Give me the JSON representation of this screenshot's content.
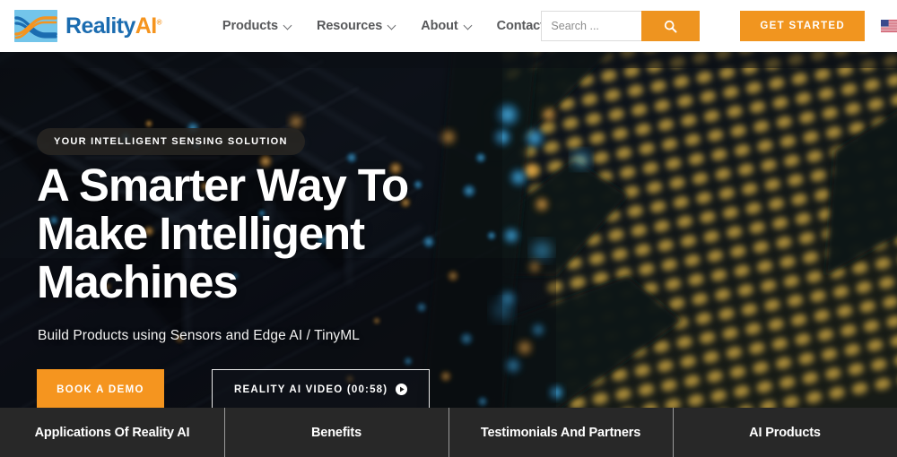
{
  "header": {
    "logo": {
      "icon": "reality-ai-waves-logo-icon",
      "text_primary": "Reality",
      "text_accent": "AI",
      "registered_mark": "®"
    },
    "nav": [
      {
        "label": "Products",
        "has_dropdown": true
      },
      {
        "label": "Resources",
        "has_dropdown": true
      },
      {
        "label": "About",
        "has_dropdown": true
      },
      {
        "label": "Contact",
        "has_dropdown": false
      }
    ],
    "search": {
      "placeholder": "Search ...",
      "value": "",
      "button_icon": "search-icon"
    },
    "get_started_label": "GET STARTED",
    "locale_flag": "us-flag-icon"
  },
  "hero": {
    "badge": "YOUR INTELLIGENT SENSING SOLUTION",
    "headline_line1": "A Smarter Way To",
    "headline_line2": "Make Intelligent",
    "headline_line3": "Machines",
    "subtitle": "Build Products using Sensors and Edge AI / TinyML",
    "cta_primary": "BOOK A DEMO",
    "cta_secondary": "REALITY AI VIDEO (00:58)",
    "cta_secondary_icon": "play-circle-icon"
  },
  "bottom_bar": {
    "items": [
      {
        "label": "Applications Of Reality AI"
      },
      {
        "label": "Benefits"
      },
      {
        "label": "Testimonials And Partners"
      },
      {
        "label": "AI Products"
      }
    ]
  },
  "colors": {
    "brand_blue": "#1b6cb0",
    "brand_orange": "#f5941e",
    "logo_tile": "#73c5ea",
    "nav_text": "#58595b",
    "bottom_bar_bg": "#282828",
    "hero_dark": "#0a0d12"
  }
}
